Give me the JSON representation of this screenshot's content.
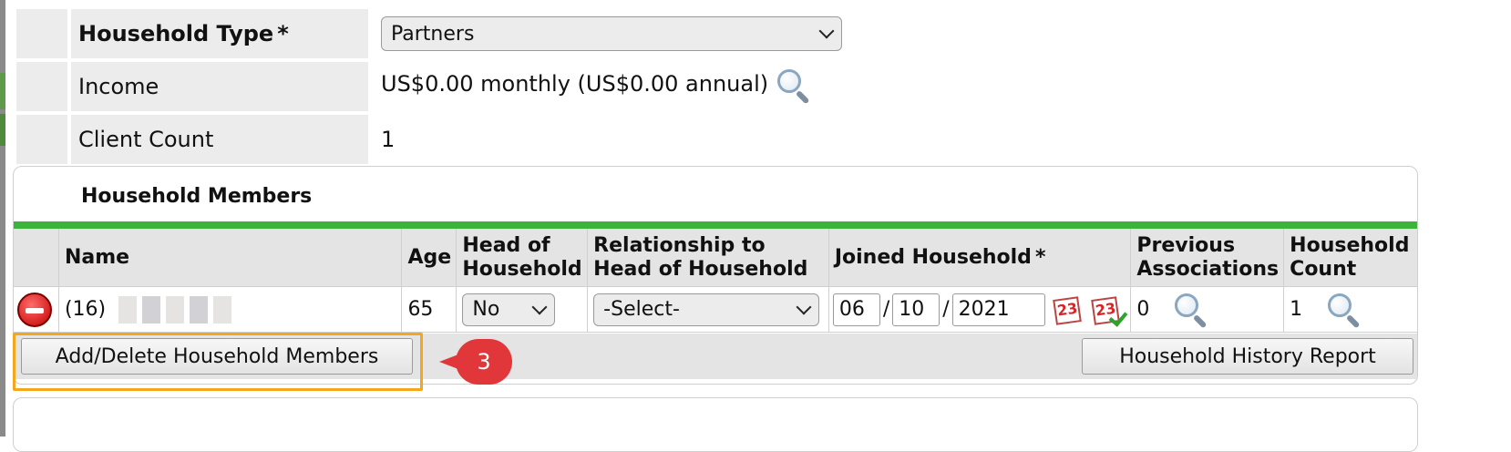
{
  "info": {
    "household_type_label": "Household Type",
    "required_marker": "*",
    "household_type_value": "Partners",
    "income_label": "Income",
    "income_value": "US$0.00 monthly (US$0.00 annual)",
    "client_count_label": "Client Count",
    "client_count_value": "1"
  },
  "members": {
    "title": "Household Members",
    "headers": {
      "name": "Name",
      "age": "Age",
      "head_line1": "Head of",
      "head_line2": "Household",
      "rel_line1": "Relationship to",
      "rel_line2": "Head of Household",
      "joined": "Joined Household",
      "joined_required": "*",
      "prev_line1": "Previous",
      "prev_line2": "Associations",
      "count_line1": "Household",
      "count_line2": "Count"
    },
    "row": {
      "name": "(16)",
      "age": "65",
      "head_of_household": "No",
      "relationship": "-Select-",
      "joined_month": "06",
      "joined_day": "10",
      "joined_year": "2021",
      "date_sep": "/",
      "calendar_number": "23",
      "previous_associations": "0",
      "household_count": "1"
    }
  },
  "buttons": {
    "add_delete": "Add/Delete Household Members",
    "history_report": "Household History Report"
  },
  "callout": {
    "step": "3",
    "color": "#e2373a"
  },
  "colors": {
    "accent_bar": "#3cb43c",
    "highlight": "#f4a61e"
  }
}
